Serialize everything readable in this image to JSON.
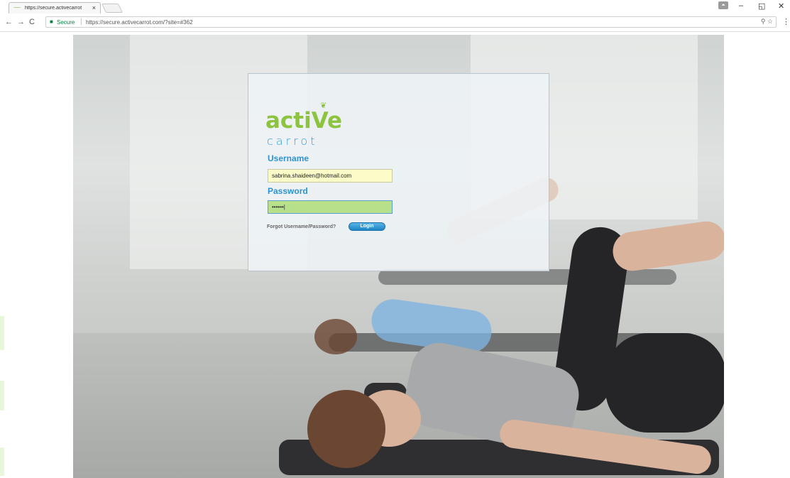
{
  "browser": {
    "tab_title": "https://secure.activecarrot",
    "tab_favicon": "~~~",
    "tab_close": "×",
    "secure_label": "Secure",
    "url": "https://secure.activecarrot.com/?site=#362",
    "window_controls": {
      "minimize": "–",
      "restore": "◱",
      "close": "✕"
    },
    "nav": {
      "back": "←",
      "forward": "→",
      "reload": "C"
    },
    "omnibox_icons": "⚲ ☆",
    "menu": "⋮",
    "lock_icon": "🔒"
  },
  "login": {
    "logo_text": "acti",
    "logo_text_v": "V",
    "logo_text_end": "e",
    "logo_sub": "carrot",
    "username_label": "Username",
    "username_value": "sabrina.shaideen@hotmail.com",
    "password_label": "Password",
    "password_value": "••••••|",
    "forgot_link": "Forgot Username/Password?",
    "login_button": "Login"
  },
  "colors": {
    "brand_green": "#8cc43f",
    "brand_blue": "#2e9fd6",
    "label_blue": "#2b93d1",
    "username_bg": "#fbfcc8",
    "password_bg": "#b6e08a"
  }
}
